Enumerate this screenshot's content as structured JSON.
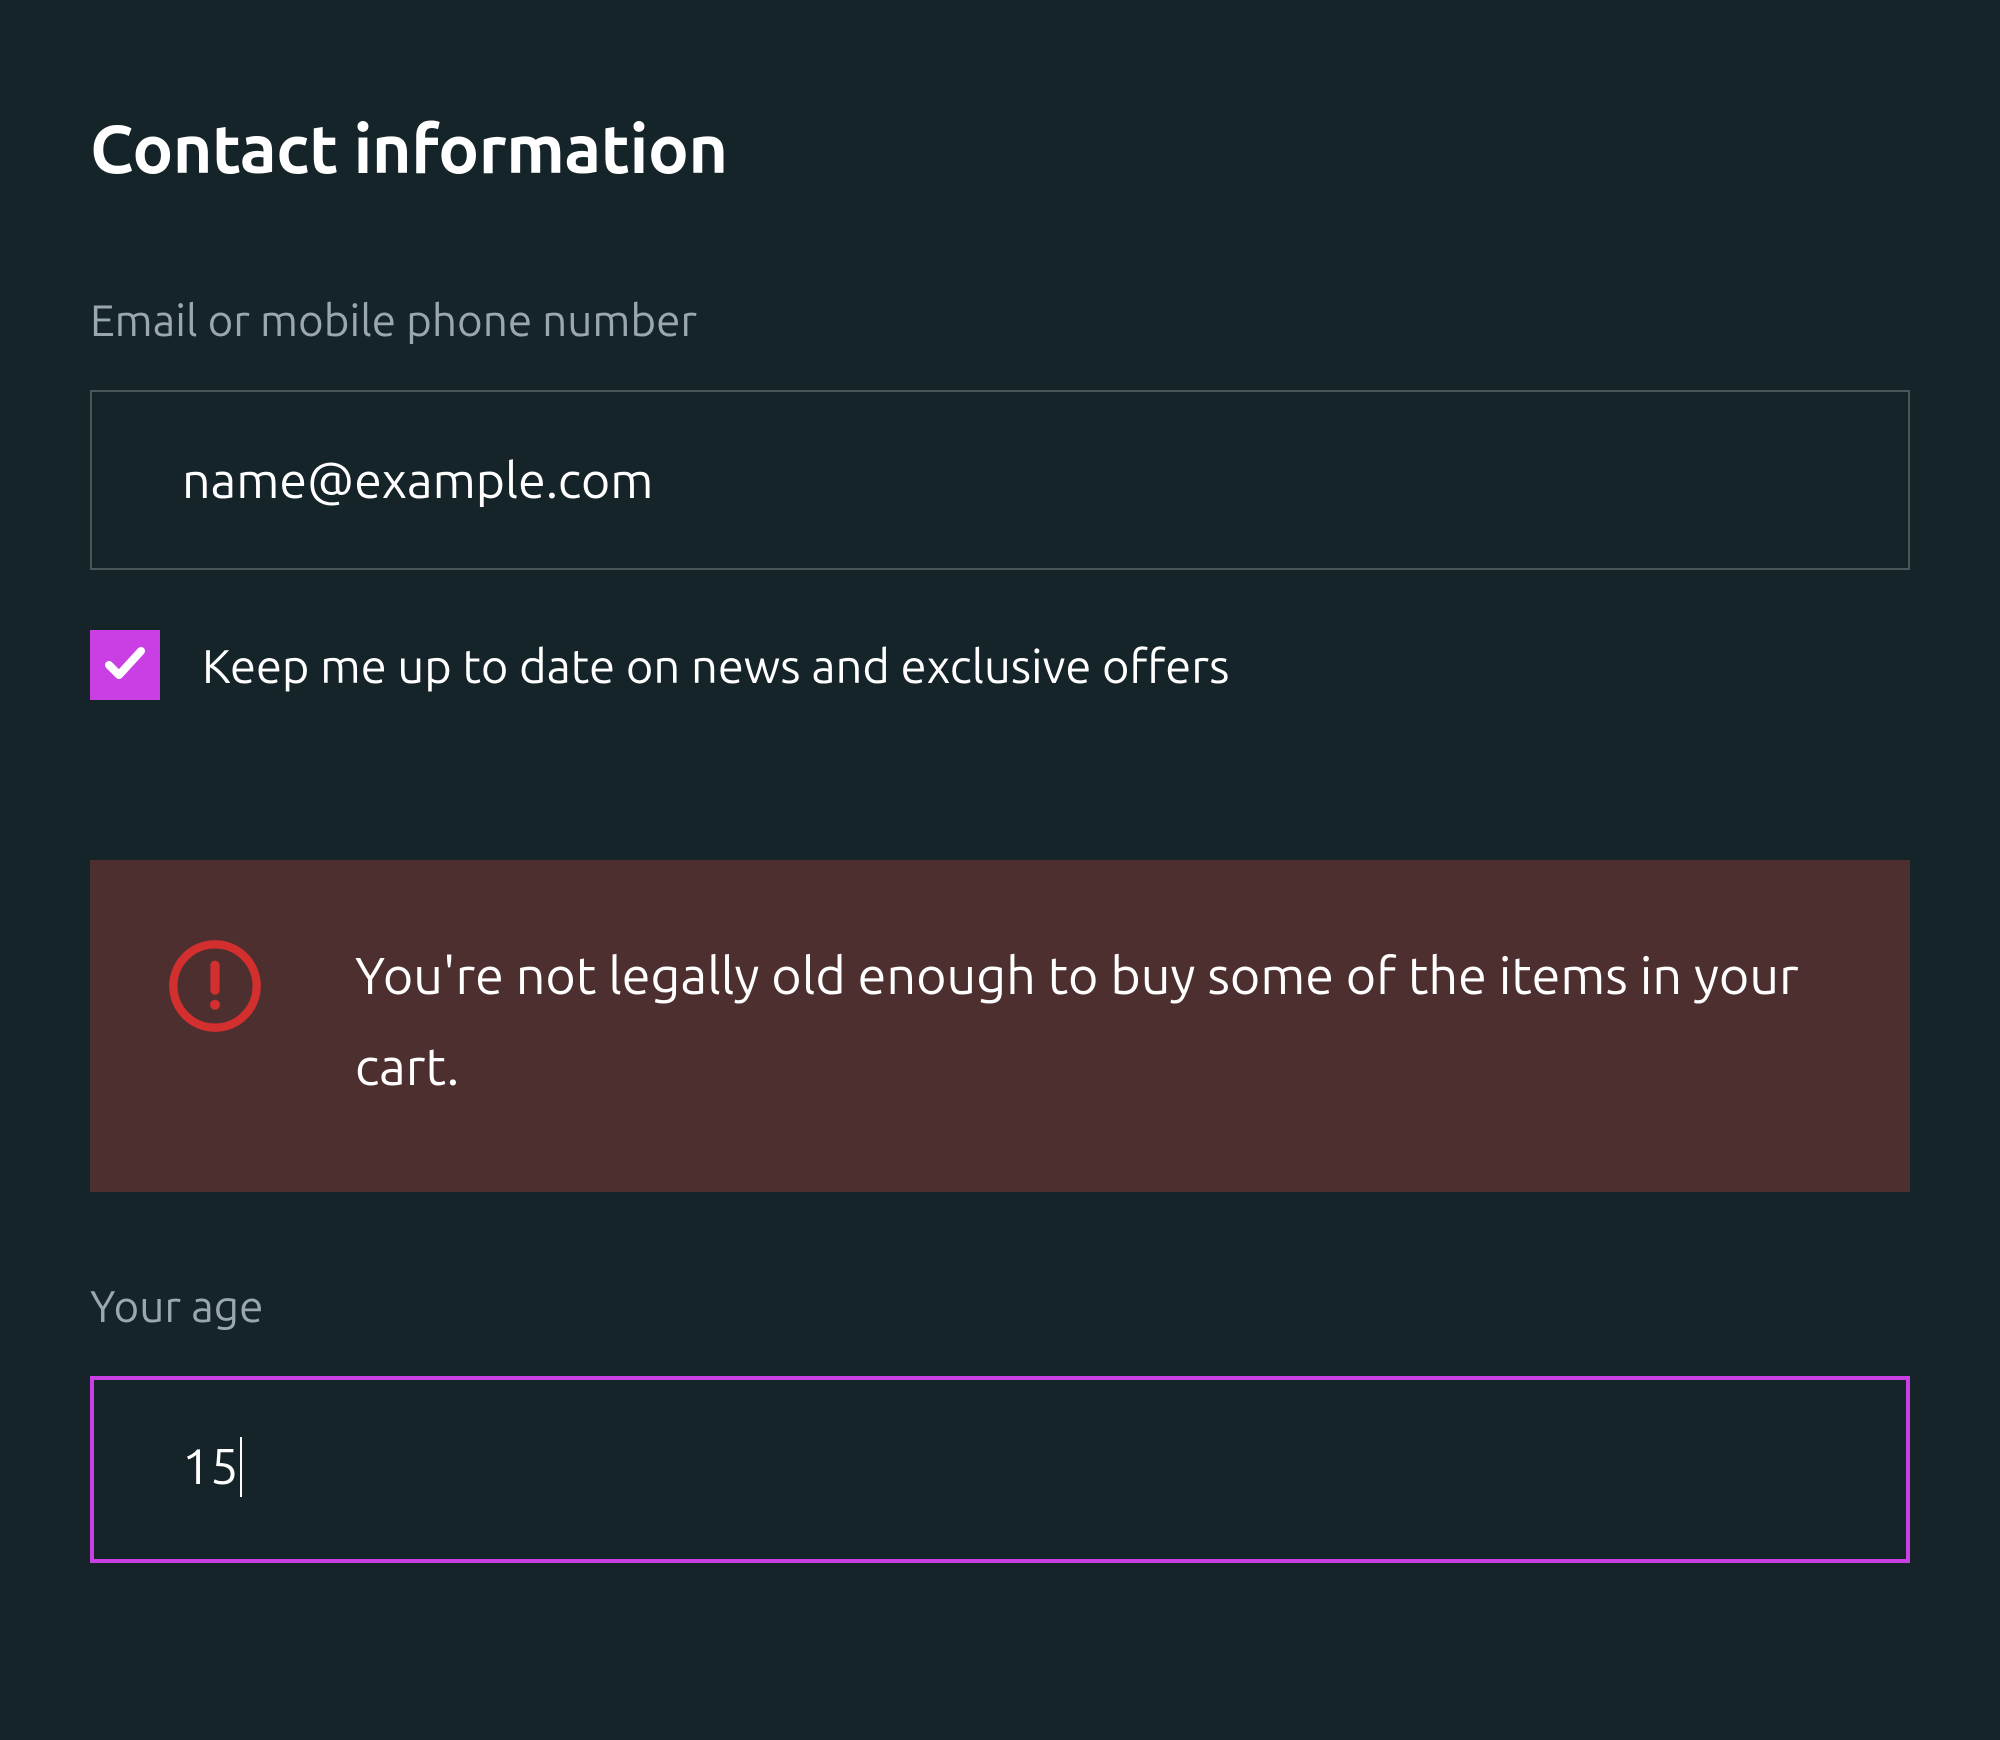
{
  "section": {
    "title": "Contact information"
  },
  "email": {
    "label": "Email or mobile phone number",
    "value": "name@example.com"
  },
  "newsletter": {
    "checked": true,
    "label": "Keep me up to date on news and exclusive offers"
  },
  "error": {
    "message": "You're not legally old enough to buy some of the items in your cart."
  },
  "age": {
    "label": "Your age",
    "value": "15"
  },
  "colors": {
    "background": "#152428",
    "accent": "#c93fe3",
    "error_icon": "#d32f2f",
    "error_bg": "#4e2f2f",
    "muted_text": "#9ba7ae"
  }
}
